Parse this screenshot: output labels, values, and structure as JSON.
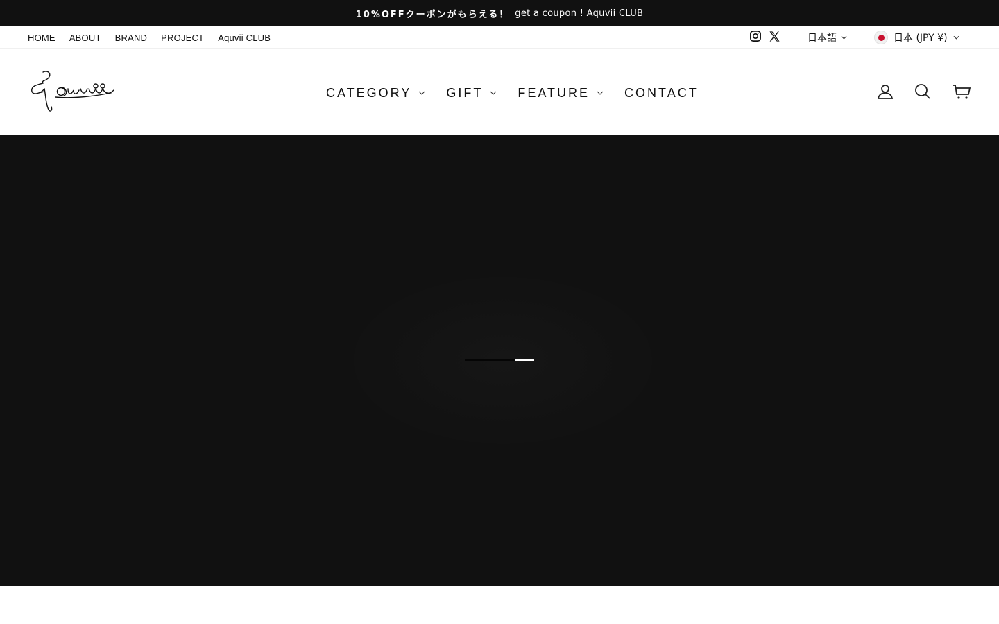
{
  "announcement": {
    "promo_text": "10%OFFクーポンがもらえる！",
    "link_text": "get a coupon ! Aquvii CLUB"
  },
  "utility_nav": {
    "items": [
      {
        "label": "HOME"
      },
      {
        "label": "ABOUT"
      },
      {
        "label": "BRAND"
      },
      {
        "label": "PROJECT"
      },
      {
        "label": "Aquvii CLUB"
      }
    ],
    "social": [
      {
        "icon": "instagram-icon"
      },
      {
        "icon": "x-icon"
      }
    ],
    "language": "日本語",
    "currency": "日本 (JPY ¥)"
  },
  "header": {
    "logo_icon": "aquvii-logo",
    "nav": [
      {
        "label": "CATEGORY",
        "dropdown": true
      },
      {
        "label": "GIFT",
        "dropdown": true
      },
      {
        "label": "FEATURE",
        "dropdown": true
      },
      {
        "label": "CONTACT",
        "dropdown": false
      }
    ],
    "icons": {
      "account": "user-icon",
      "search": "search-icon",
      "cart": "cart-icon"
    }
  },
  "colors": {
    "dark": "#111111",
    "white": "#ffffff",
    "flag_red": "#c8102e"
  }
}
